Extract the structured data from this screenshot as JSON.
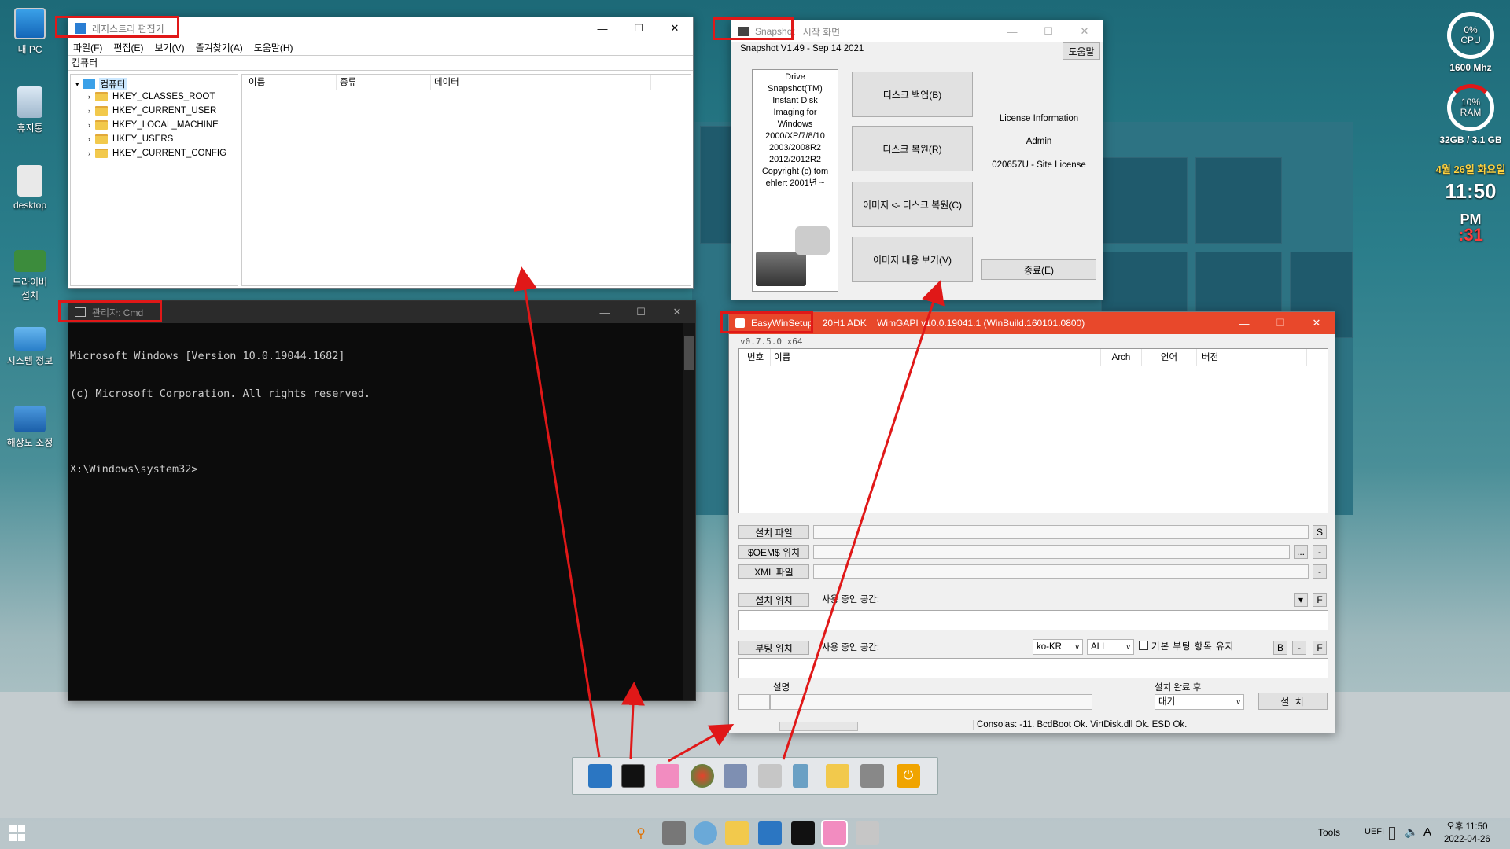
{
  "desktop": {
    "icons": [
      {
        "label": "내 PC"
      },
      {
        "label": "휴지통"
      },
      {
        "label": "desktop"
      },
      {
        "label": "드라이버 설치"
      },
      {
        "label": "시스템 정보"
      },
      {
        "label": "해상도 조정"
      }
    ],
    "gadget": {
      "cpu_percent": "0%",
      "cpu_label": "CPU",
      "cpu_speed": "1600 Mhz",
      "ram_percent": "10%",
      "ram_label": "RAM",
      "ram_total": "32GB / 3.1 GB",
      "date": "4월 26일 화요일",
      "time": "11:50",
      "ampm": "PM",
      "seconds": ":31"
    }
  },
  "regedit": {
    "title": "레지스트리 편집기",
    "menu": [
      "파일(F)",
      "편집(E)",
      "보기(V)",
      "즐겨찾기(A)",
      "도움말(H)"
    ],
    "address": "컴퓨터",
    "tree_root": "컴퓨터",
    "tree_items": [
      "HKEY_CLASSES_ROOT",
      "HKEY_CURRENT_USER",
      "HKEY_LOCAL_MACHINE",
      "HKEY_USERS",
      "HKEY_CURRENT_CONFIG"
    ],
    "columns": [
      "이름",
      "종류",
      "데이터"
    ]
  },
  "cmd": {
    "title": "관리자: Cmd",
    "lines": [
      "Microsoft Windows [Version 10.0.19044.1682]",
      "(c) Microsoft Corporation. All rights reserved.",
      "",
      "X:\\Windows\\system32>"
    ]
  },
  "snapshot": {
    "title_hl": "Snapshot",
    "title_rest": "시작 화면",
    "version": "Snapshot V1.49 - Sep 14 2021",
    "help_button": "도움말",
    "about_text": "Drive Snapshot(TM) Instant Disk Imaging for Windows 2000/XP/7/8/10 2003/2008R2 2012/2012R2 Copyright (c) tom ehlert 2001년 ~",
    "buttons": [
      "디스크 백업(B)",
      "디스크 복원(R)",
      "이미지 <- 디스크 복원(C)",
      "이미지 내용 보기(V)"
    ],
    "license_title": "License Information",
    "license_user": "Admin",
    "license_key": "020657U - Site License",
    "exit_button": "종료(E)"
  },
  "easywinsetup": {
    "title_hl": "EasyWinSetup",
    "title_rest": "20H1 ADK    WimGAPI v10.0.19041.1 (WinBuild.160101.0800)",
    "version": "v0.7.5.0 x64",
    "columns": [
      "번호",
      "이름",
      "Arch",
      "언어",
      "버전"
    ],
    "install_file_label": "설치 파일",
    "install_file_btn": "S",
    "oem_label": "$OEM$ 위치",
    "oem_btn1": "...",
    "oem_btn2": "-",
    "xml_label": "XML 파일",
    "xml_btn": "-",
    "install_loc_label": "설치 위치",
    "install_loc_used": "사용 중인 공간:",
    "install_loc_dropdown": "▾",
    "install_loc_btn": "F",
    "boot_loc_label": "부팅 위치",
    "boot_loc_used": "사용 중인 공간:",
    "lang_select": "ko-KR",
    "all_select": "ALL",
    "keep_boot_label": "기본 부팅 항목 유지",
    "boot_btn_b": "B",
    "boot_btn_dash": "-",
    "boot_btn_f": "F",
    "desc_label": "설명",
    "after_install_label": "설치 완료 후",
    "after_install_value": "대기",
    "install_button": "설 치",
    "status": "Consolas: -11. BcdBoot Ok. VirtDisk.dll Ok. ESD Ok."
  },
  "taskbar": {
    "tools_label": "Tools",
    "uefi_label": "UEFI",
    "ime": "A",
    "time": "오후 11:50",
    "date": "2022-04-26"
  },
  "colors": {
    "highlight": "#e01818",
    "ews_title": "#e8482b",
    "cmd_bg": "#0c0c0c"
  }
}
